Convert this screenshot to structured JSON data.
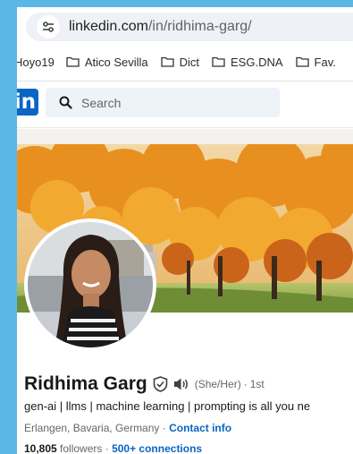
{
  "browser": {
    "url_host": "linkedin.com",
    "url_path": "/in/ridhima-garg/",
    "bookmarks": [
      {
        "label": "Hoyo19",
        "icon": "none"
      },
      {
        "label": "Atico Sevilla",
        "icon": "folder-icon"
      },
      {
        "label": "Dict",
        "icon": "folder-icon"
      },
      {
        "label": "ESG.DNA",
        "icon": "folder-icon"
      },
      {
        "label": "Fav.",
        "icon": "folder-icon"
      }
    ]
  },
  "linkedin": {
    "logo_text": "in",
    "search_placeholder": "Search",
    "brand_color": "#0a66c2"
  },
  "profile": {
    "name": "Ridhima Garg",
    "pronouns": "(She/Her)",
    "separator": "·",
    "degree": "1st",
    "headline": "gen-ai | llms | machine learning | prompting is all you ne",
    "location": "Erlangen, Bavaria, Germany",
    "location_sep": " · ",
    "contact_label": "Contact info",
    "followers_count": "10,805",
    "followers_label": " followers",
    "connections_sep": " · ",
    "connections_label": "500+ connections"
  }
}
